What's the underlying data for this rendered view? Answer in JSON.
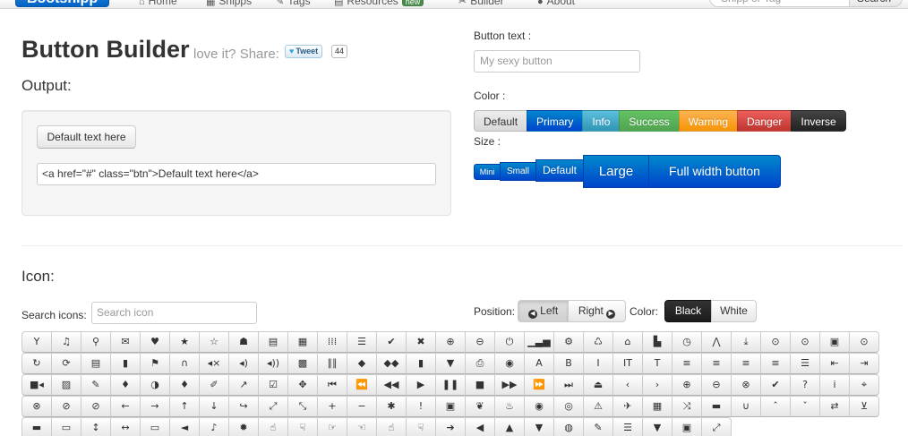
{
  "navbar": {
    "brand": "Bootsnipp",
    "items": [
      {
        "icon": "home-icon",
        "glyph": "⌂",
        "label": "Home"
      },
      {
        "icon": "snippets-icon",
        "glyph": "▦",
        "label": "Snipps"
      },
      {
        "icon": "tags-icon",
        "glyph": "✎",
        "label": "Tags"
      },
      {
        "icon": "resources-icon",
        "glyph": "▤",
        "label": "Resources",
        "badge": "new"
      },
      {
        "icon": "builder-icon",
        "glyph": "✂",
        "label": "Builder"
      },
      {
        "icon": "about-icon",
        "glyph": "●",
        "label": "About"
      }
    ],
    "search_placeholder": "Snipp or Tag",
    "search_button": "Search"
  },
  "header": {
    "title": "Button Builder",
    "tagline": "love it? Share:",
    "tweet_label": "Tweet",
    "tweet_count": "44",
    "output_label": "Output:"
  },
  "preview": {
    "button_text": "Default text here",
    "code": "<a href=\"#\" class=\"btn\">Default text here</a>"
  },
  "controls": {
    "button_text_label": "Button text :",
    "button_text_placeholder": "My sexy button",
    "color_label": "Color :",
    "colors": [
      "Default",
      "Primary",
      "Info",
      "Success",
      "Warning",
      "Danger",
      "Inverse"
    ],
    "size_label": "Size :",
    "sizes": [
      "Mini",
      "Small",
      "Default",
      "Large",
      "Full width button"
    ]
  },
  "icon_section": {
    "label": "Icon:",
    "search_label": "Search icons:",
    "search_placeholder": "Search icon",
    "position_label": "Position:",
    "position_left": "Left",
    "position_right": "Right",
    "color_label": "Color:",
    "color_black": "Black",
    "color_white": "White"
  },
  "icon_rows": [
    [
      {
        "name": "glass-icon",
        "g": "Y"
      },
      {
        "name": "music-icon",
        "g": "♫"
      },
      {
        "name": "search-icon",
        "g": "⚲"
      },
      {
        "name": "envelope-icon",
        "g": "✉"
      },
      {
        "name": "heart-icon",
        "g": "♥"
      },
      {
        "name": "star-icon",
        "g": "★"
      },
      {
        "name": "star-empty-icon",
        "g": "☆"
      },
      {
        "name": "user-icon",
        "g": "☗"
      },
      {
        "name": "film-icon",
        "g": "▤"
      },
      {
        "name": "th-large-icon",
        "g": "▦"
      },
      {
        "name": "th-icon",
        "g": "⁞⁞⁞"
      },
      {
        "name": "th-list-icon",
        "g": "☰"
      },
      {
        "name": "ok-icon",
        "g": "✔"
      },
      {
        "name": "remove-icon",
        "g": "✖"
      },
      {
        "name": "zoom-in-icon",
        "g": "⊕"
      },
      {
        "name": "zoom-out-icon",
        "g": "⊖"
      },
      {
        "name": "off-icon",
        "g": "⏻"
      },
      {
        "name": "signal-icon",
        "g": "▁▃▅"
      },
      {
        "name": "cog-icon",
        "g": "⚙"
      },
      {
        "name": "trash-icon",
        "g": "♺"
      },
      {
        "name": "home-icon",
        "g": "⌂"
      },
      {
        "name": "file-icon",
        "g": "▙"
      },
      {
        "name": "time-icon",
        "g": "◷"
      },
      {
        "name": "road-icon",
        "g": "⋀"
      },
      {
        "name": "download-alt-icon",
        "g": "⤓"
      },
      {
        "name": "download-icon",
        "g": "⊙"
      },
      {
        "name": "upload-icon",
        "g": "⊙"
      },
      {
        "name": "inbox-icon",
        "g": "▣"
      },
      {
        "name": "play-circle-icon",
        "g": "⊙"
      }
    ],
    [
      {
        "name": "repeat-icon",
        "g": "↻"
      },
      {
        "name": "refresh-icon",
        "g": "⟳"
      },
      {
        "name": "list-alt-icon",
        "g": "▤"
      },
      {
        "name": "lock-icon",
        "g": "▮"
      },
      {
        "name": "flag-icon",
        "g": "⚑"
      },
      {
        "name": "headphones-icon",
        "g": "∩"
      },
      {
        "name": "volume-off-icon",
        "g": "◂×"
      },
      {
        "name": "volume-down-icon",
        "g": "◂)"
      },
      {
        "name": "volume-up-icon",
        "g": "◂))"
      },
      {
        "name": "qrcode-icon",
        "g": "▩"
      },
      {
        "name": "barcode-icon",
        "g": "∥∥"
      },
      {
        "name": "tag-icon",
        "g": "◆"
      },
      {
        "name": "tags-icon",
        "g": "◆◆"
      },
      {
        "name": "book-icon",
        "g": "▮"
      },
      {
        "name": "bookmark-icon",
        "g": "▼"
      },
      {
        "name": "print-icon",
        "g": "⎙"
      },
      {
        "name": "camera-icon",
        "g": "◉"
      },
      {
        "name": "font-icon",
        "g": "A"
      },
      {
        "name": "bold-icon",
        "g": "B"
      },
      {
        "name": "italic-icon",
        "g": "I"
      },
      {
        "name": "text-height-icon",
        "g": "IT"
      },
      {
        "name": "text-width-icon",
        "g": "T"
      },
      {
        "name": "align-left-icon",
        "g": "≡"
      },
      {
        "name": "align-center-icon",
        "g": "≡"
      },
      {
        "name": "align-right-icon",
        "g": "≡"
      },
      {
        "name": "align-justify-icon",
        "g": "≡"
      },
      {
        "name": "list-icon",
        "g": "☰"
      },
      {
        "name": "indent-left-icon",
        "g": "⇤"
      },
      {
        "name": "indent-right-icon",
        "g": "⇥"
      }
    ],
    [
      {
        "name": "facetime-video-icon",
        "g": "■◂"
      },
      {
        "name": "picture-icon",
        "g": "▨"
      },
      {
        "name": "pencil-icon",
        "g": "✎"
      },
      {
        "name": "map-marker-icon",
        "g": "♦"
      },
      {
        "name": "adjust-icon",
        "g": "◑"
      },
      {
        "name": "tint-icon",
        "g": "♦"
      },
      {
        "name": "edit-icon",
        "g": "✐"
      },
      {
        "name": "share-icon",
        "g": "↗"
      },
      {
        "name": "check-icon",
        "g": "☑"
      },
      {
        "name": "move-icon",
        "g": "✥"
      },
      {
        "name": "step-backward-icon",
        "g": "⏮"
      },
      {
        "name": "fast-backward-icon",
        "g": "⏪"
      },
      {
        "name": "backward-icon",
        "g": "◀◀"
      },
      {
        "name": "play-icon",
        "g": "▶"
      },
      {
        "name": "pause-icon",
        "g": "❚❚"
      },
      {
        "name": "stop-icon",
        "g": "■"
      },
      {
        "name": "forward-icon",
        "g": "▶▶"
      },
      {
        "name": "fast-forward-icon",
        "g": "⏩"
      },
      {
        "name": "step-forward-icon",
        "g": "⏭"
      },
      {
        "name": "eject-icon",
        "g": "⏏"
      },
      {
        "name": "chevron-left-icon",
        "g": "‹"
      },
      {
        "name": "chevron-right-icon",
        "g": "›"
      },
      {
        "name": "plus-sign-icon",
        "g": "⊕"
      },
      {
        "name": "minus-sign-icon",
        "g": "⊖"
      },
      {
        "name": "remove-sign-icon",
        "g": "⊗"
      },
      {
        "name": "ok-sign-icon",
        "g": "✔"
      },
      {
        "name": "question-sign-icon",
        "g": "?"
      },
      {
        "name": "info-sign-icon",
        "g": "i"
      },
      {
        "name": "screenshot-icon",
        "g": "⌖"
      }
    ],
    [
      {
        "name": "remove-circle-icon",
        "g": "⊗"
      },
      {
        "name": "ok-circle-icon",
        "g": "⊘"
      },
      {
        "name": "ban-circle-icon",
        "g": "⊘"
      },
      {
        "name": "arrow-left-icon",
        "g": "←"
      },
      {
        "name": "arrow-right-icon",
        "g": "→"
      },
      {
        "name": "arrow-up-icon",
        "g": "↑"
      },
      {
        "name": "arrow-down-icon",
        "g": "↓"
      },
      {
        "name": "share-alt-icon",
        "g": "↪"
      },
      {
        "name": "resize-full-icon",
        "g": "⤢"
      },
      {
        "name": "resize-small-icon",
        "g": "⤡"
      },
      {
        "name": "plus-icon",
        "g": "+"
      },
      {
        "name": "minus-icon",
        "g": "−"
      },
      {
        "name": "asterisk-icon",
        "g": "✱"
      },
      {
        "name": "exclamation-sign-icon",
        "g": "!"
      },
      {
        "name": "gift-icon",
        "g": "▣"
      },
      {
        "name": "leaf-icon",
        "g": "❦"
      },
      {
        "name": "fire-icon",
        "g": "♨"
      },
      {
        "name": "eye-open-icon",
        "g": "◉"
      },
      {
        "name": "eye-close-icon",
        "g": "◎"
      },
      {
        "name": "warning-sign-icon",
        "g": "⚠"
      },
      {
        "name": "plane-icon",
        "g": "✈"
      },
      {
        "name": "calendar-icon",
        "g": "▦"
      },
      {
        "name": "random-icon",
        "g": "⤨"
      },
      {
        "name": "comment-icon",
        "g": "▬"
      },
      {
        "name": "magnet-icon",
        "g": "∪"
      },
      {
        "name": "chevron-up-icon",
        "g": "ˆ"
      },
      {
        "name": "chevron-down-icon",
        "g": "ˇ"
      },
      {
        "name": "retweet-icon",
        "g": "⇄"
      },
      {
        "name": "shopping-cart-icon",
        "g": "⊻"
      }
    ],
    [
      {
        "name": "folder-close-icon",
        "g": "▬"
      },
      {
        "name": "folder-open-icon",
        "g": "▭"
      },
      {
        "name": "resize-vertical-icon",
        "g": "↕"
      },
      {
        "name": "resize-horizontal-icon",
        "g": "↔"
      },
      {
        "name": "hdd-icon",
        "g": "▭"
      },
      {
        "name": "bullhorn-icon",
        "g": "◄"
      },
      {
        "name": "bell-icon",
        "g": "♪"
      },
      {
        "name": "certificate-icon",
        "g": "✹"
      },
      {
        "name": "thumbs-up-icon",
        "g": "☝"
      },
      {
        "name": "thumbs-down-icon",
        "g": "☟"
      },
      {
        "name": "hand-right-icon",
        "g": "☞"
      },
      {
        "name": "hand-left-icon",
        "g": "☜"
      },
      {
        "name": "hand-up-icon",
        "g": "☝"
      },
      {
        "name": "hand-down-icon",
        "g": "☟"
      },
      {
        "name": "circle-arrow-right-icon",
        "g": "➔"
      },
      {
        "name": "circle-arrow-left-icon",
        "g": "◀"
      },
      {
        "name": "circle-arrow-up-icon",
        "g": "▲"
      },
      {
        "name": "circle-arrow-down-icon",
        "g": "▼"
      },
      {
        "name": "globe-icon",
        "g": "◍"
      },
      {
        "name": "wrench-icon",
        "g": "✎"
      },
      {
        "name": "tasks-icon",
        "g": "☰"
      },
      {
        "name": "filter-icon",
        "g": "▼"
      },
      {
        "name": "briefcase-icon",
        "g": "▣"
      },
      {
        "name": "fullscreen-icon",
        "g": "⤢"
      }
    ]
  ]
}
